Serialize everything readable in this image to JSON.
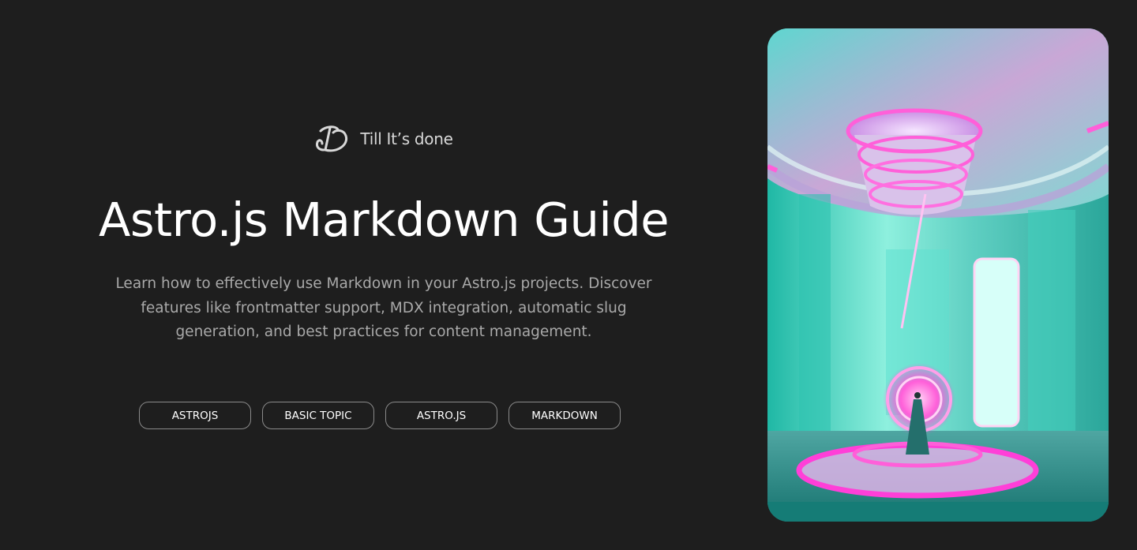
{
  "brand": {
    "logo_icon": "brand-logo-icon",
    "name": "Till It’s done"
  },
  "hero": {
    "title": "Astro.js Markdown Guide",
    "description": "Learn how to effectively use Markdown in your Astro.js projects. Discover features like frontmatter support, MDX integration, automatic slug generation, and best practices for content management."
  },
  "tags": [
    {
      "label": "ASTROJS"
    },
    {
      "label": "BASIC TOPIC"
    },
    {
      "label": "ASTRO.JS"
    },
    {
      "label": "MARKDOWN"
    }
  ],
  "image": {
    "description_icon": "neon-room-illustration"
  },
  "colors": {
    "background": "#1e1e1e",
    "tag_border": "#8a8a8a",
    "description_text": "#a9a9a9",
    "neon_pink": "#ff3fd8",
    "neon_teal": "#3ff0d2"
  }
}
